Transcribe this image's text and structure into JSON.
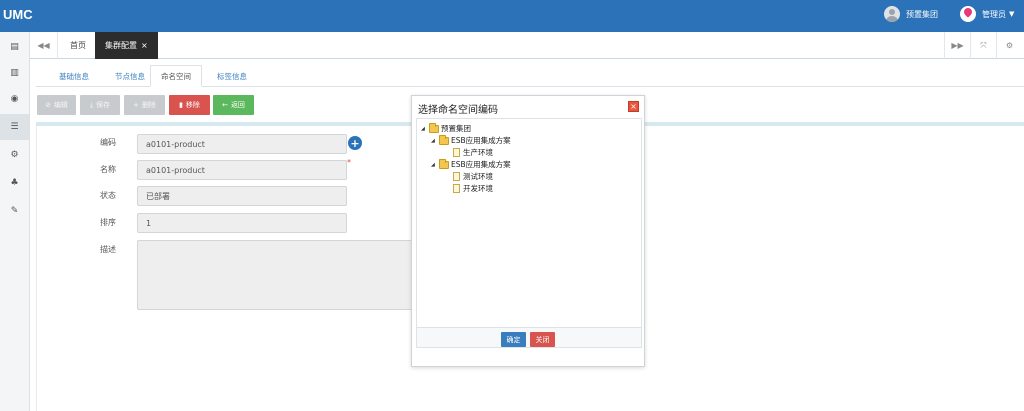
{
  "app": {
    "logo": "UMC"
  },
  "topbar": {
    "group_name": "预置集团",
    "user_name": "管理员"
  },
  "tabs": {
    "home": "首页",
    "active": "集群配置",
    "close_glyph": "×"
  },
  "subtabs": [
    "基础信息",
    "节点信息",
    "命名空间",
    "标签信息"
  ],
  "toolbar": {
    "edit": "编辑",
    "save": "保存",
    "delete": "删除",
    "remove": "移除",
    "back": "返回"
  },
  "form": {
    "code_label": "编码",
    "code_value": "a0101-product",
    "name_label": "名称",
    "name_value": "a0101-product",
    "status_label": "状态",
    "status_value": "已部署",
    "order_label": "排序",
    "order_value": "1",
    "desc_label": "描述",
    "required_mark": "*"
  },
  "dialog": {
    "title": "选择命名空间编码",
    "close_glyph": "×",
    "tree": {
      "root": "预置集团",
      "group1": "ESB应用集成方案",
      "group1_child": "生产环境",
      "group2": "ESB应用集成方案",
      "group2_child1": "测试环境",
      "group2_child2": "开发环境"
    },
    "confirm": "确定",
    "close": "关闭"
  },
  "colors": {
    "topbar": "#2b72b8",
    "red": "#d9534f",
    "green": "#5cb85c",
    "confirm": "#3a7dbf"
  }
}
